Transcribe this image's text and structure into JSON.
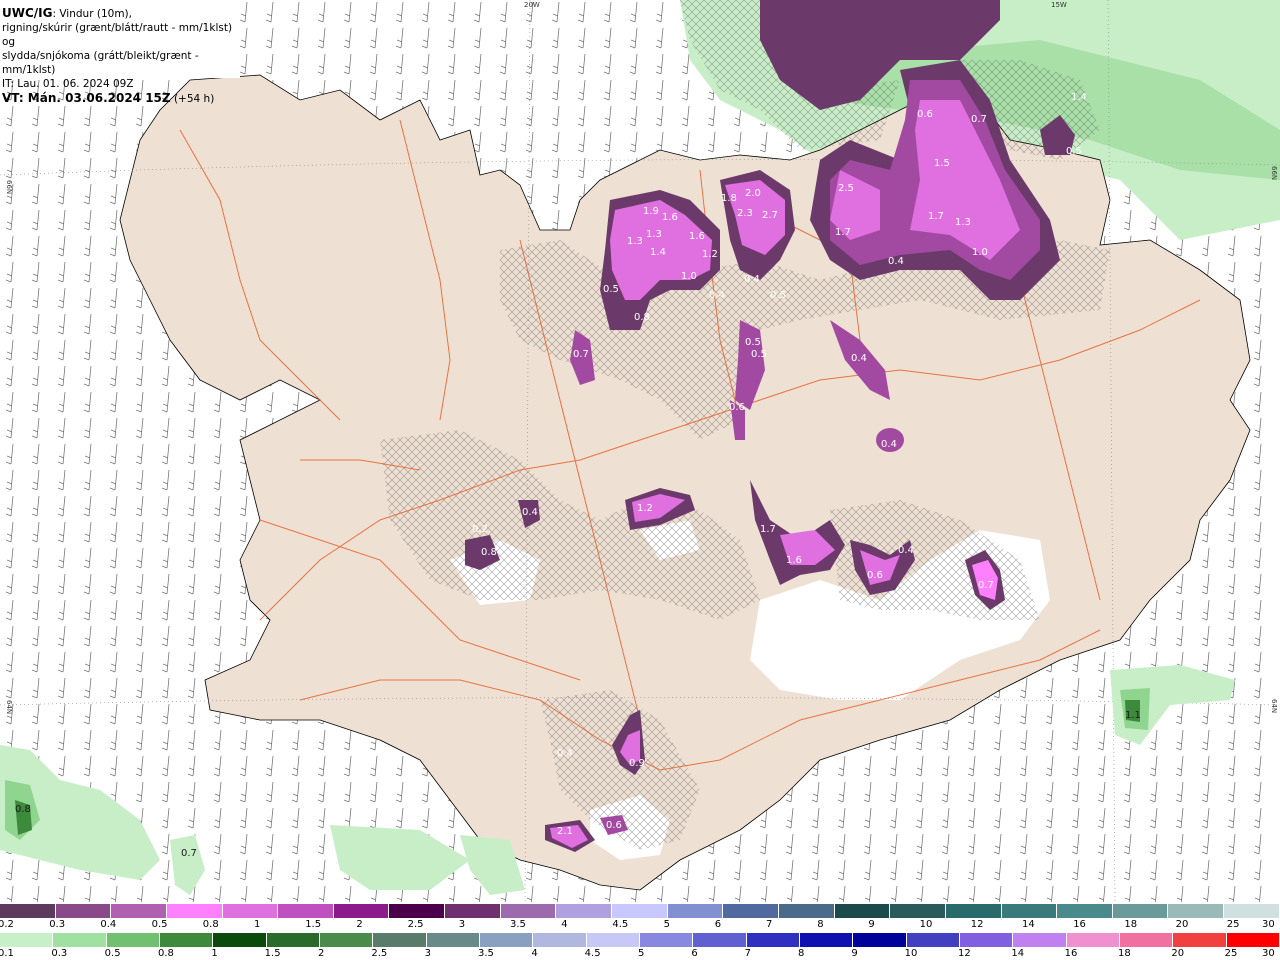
{
  "header": {
    "code": "UWC/IG",
    "line1_rest": ": Vindur (10m),",
    "line2": "rigning/skúrir (grænt/blátt/rautt - mm/1klst) og",
    "line3": "slydda/snjókoma (grátt/bleikt/grænt - mm/1klst)",
    "line4": "IT: Lau. 01. 06. 2024 09Z",
    "line5_label": "VT: Mán. 03.06.2024 15Z",
    "line5_rest": " (+54 h)"
  },
  "coords": {
    "top_left": "20W",
    "top_right": "15W",
    "left_upper": "66N",
    "left_lower": "64N",
    "right_upper": "66N",
    "right_lower": "64N"
  },
  "colors": {
    "land": "#eee0d2",
    "road": "#e8602a",
    "rain_light": "#c8eec8",
    "rain_mid": "#8fd48f",
    "rain_dark": "#3d8a3d",
    "snow_dark": "#6b3a6b",
    "snow_mid": "#a24aa2",
    "snow_light": "#e070e0",
    "snow_bright": "#ff80ff",
    "barb": "#666666"
  },
  "precip_labels": [
    {
      "id": "a",
      "text": "0.6"
    },
    {
      "id": "b",
      "text": "0.7"
    },
    {
      "id": "c",
      "text": "1.5"
    },
    {
      "id": "d",
      "text": "1.7"
    },
    {
      "id": "e",
      "text": "1.3"
    },
    {
      "id": "f",
      "text": "1.0"
    },
    {
      "id": "g",
      "text": "0.4"
    },
    {
      "id": "h",
      "text": "2.5"
    },
    {
      "id": "i",
      "text": "1.7"
    },
    {
      "id": "j",
      "text": "2.0"
    },
    {
      "id": "k",
      "text": "1.8"
    },
    {
      "id": "l",
      "text": "2.3"
    },
    {
      "id": "m",
      "text": "2.7"
    },
    {
      "id": "n",
      "text": "1.9"
    },
    {
      "id": "o",
      "text": "1.6"
    },
    {
      "id": "p",
      "text": "1.3"
    },
    {
      "id": "q",
      "text": "1.3"
    },
    {
      "id": "r",
      "text": "1.4"
    },
    {
      "id": "s",
      "text": "1.6"
    },
    {
      "id": "t",
      "text": "1.2"
    },
    {
      "id": "u",
      "text": "1.0"
    },
    {
      "id": "v",
      "text": "0.4"
    },
    {
      "id": "w",
      "text": "0.5"
    },
    {
      "id": "x",
      "text": "0.5"
    },
    {
      "id": "y",
      "text": "0.8"
    },
    {
      "id": "z",
      "text": "0.7"
    },
    {
      "id": "aa",
      "text": "0.4"
    },
    {
      "id": "ab",
      "text": "0.5"
    },
    {
      "id": "ac",
      "text": "0.5"
    },
    {
      "id": "ad",
      "text": "0.4"
    },
    {
      "id": "ae",
      "text": "0.6"
    },
    {
      "id": "af",
      "text": "0.4"
    },
    {
      "id": "ag",
      "text": "1.2"
    },
    {
      "id": "ah",
      "text": "0.4"
    },
    {
      "id": "ai",
      "text": "0.2"
    },
    {
      "id": "aj",
      "text": "0.8"
    },
    {
      "id": "ak",
      "text": "1.7"
    },
    {
      "id": "al",
      "text": "1.6"
    },
    {
      "id": "am",
      "text": "0.6"
    },
    {
      "id": "an",
      "text": "0.4"
    },
    {
      "id": "ao",
      "text": "0.7"
    },
    {
      "id": "ap",
      "text": "0.4"
    },
    {
      "id": "aq",
      "text": "0.9"
    },
    {
      "id": "ar",
      "text": "2.1"
    },
    {
      "id": "as",
      "text": "0.6"
    },
    {
      "id": "at",
      "text": "0.8"
    },
    {
      "id": "au",
      "text": "0.7"
    },
    {
      "id": "av",
      "text": "1.1"
    },
    {
      "id": "aw",
      "text": "1.4"
    },
    {
      "id": "ax",
      "text": "0.5"
    }
  ],
  "legend": {
    "snow_colors": [
      "#5e3a5e",
      "#8a4a8a",
      "#b060b0",
      "#ff80ff",
      "#e070e0",
      "#c050c0",
      "#8c1a8c",
      "#4a004a",
      "#703070",
      "#9e6aae",
      "#b0a0e0",
      "#c8c8ff",
      "#8090d0",
      "#506aa0",
      "#4a6a8a",
      "#1a4a4a",
      "#2a5a5a",
      "#2a6a6a",
      "#3a7a7a",
      "#4a8a8a",
      "#6a9a9a",
      "#9ababa",
      "#d0e0e0"
    ],
    "snow_labels": [
      "0.2",
      "0.3",
      "0.4",
      "0.5",
      "0.8",
      "1",
      "1.5",
      "2",
      "2.5",
      "3",
      "3.5",
      "4",
      "4.5",
      "5",
      "6",
      "7",
      "8",
      "9",
      "10",
      "12",
      "14",
      "16",
      "18",
      "20",
      "25",
      "30"
    ],
    "rain_colors": [
      "#c8f0c8",
      "#a0e0a0",
      "#70c070",
      "#3d8a3d",
      "#0a4a0a",
      "#2a6a2a",
      "#4a8a4a",
      "#5a7a6a",
      "#6a8a8a",
      "#8aa0c0",
      "#b0b8e0",
      "#c8c8f8",
      "#8888e0",
      "#6060d0",
      "#3030c0",
      "#1010b0",
      "#00009a",
      "#4040c0",
      "#8060e0",
      "#c080f0",
      "#f090d0",
      "#f070a0",
      "#f04040",
      "#ff0000"
    ],
    "rain_labels": [
      "0.1",
      "0.3",
      "0.5",
      "0.8",
      "1",
      "1.5",
      "2",
      "2.5",
      "3",
      "3.5",
      "4",
      "4.5",
      "5",
      "6",
      "7",
      "8",
      "9",
      "10",
      "12",
      "14",
      "16",
      "18",
      "20",
      "25",
      "30"
    ]
  }
}
